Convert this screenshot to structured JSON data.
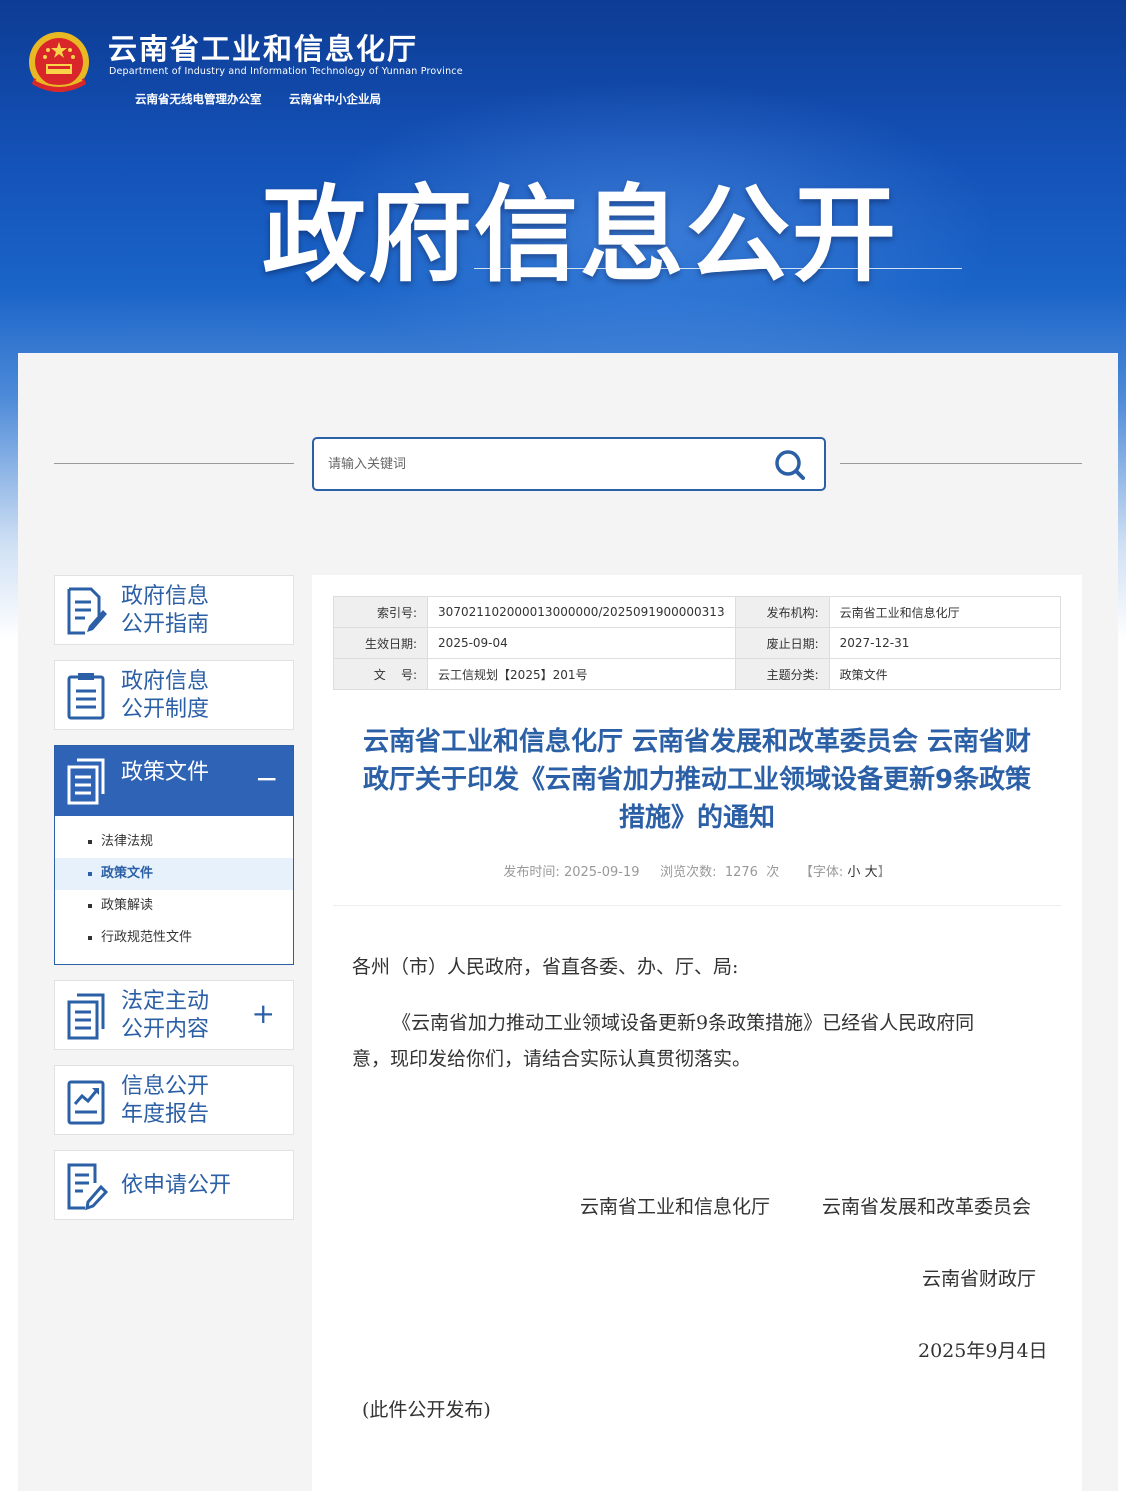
{
  "header": {
    "org_name": "云南省工业和信息化厅",
    "org_name_en": "Department of Industry and Information Technology of Yunnan Province",
    "sub_orgs": [
      "云南省无线电管理办公室",
      "云南省中小企业局"
    ],
    "banner_title": "政府信息公开"
  },
  "search": {
    "placeholder": "请输入关键词"
  },
  "sidebar": {
    "items": [
      {
        "line1": "政府信息",
        "line2": "公开指南",
        "icon": "document-pen-icon"
      },
      {
        "line1": "政府信息",
        "line2": "公开制度",
        "icon": "clipboard-icon"
      },
      {
        "line1": "政策文件",
        "icon": "files-icon",
        "toggle": "−",
        "active": true,
        "sub": [
          "法律法规",
          "政策文件",
          "政策解读",
          "行政规范性文件"
        ],
        "selected_sub": 1
      },
      {
        "line1": "法定主动",
        "line2": "公开内容",
        "icon": "files-icon",
        "toggle": "+"
      },
      {
        "line1": "信息公开",
        "line2": "年度报告",
        "icon": "chart-report-icon"
      },
      {
        "line1": "依申请公开",
        "icon": "edit-document-icon"
      }
    ]
  },
  "meta": {
    "index_label": "索引号:",
    "index_value": "307021102000013000000/2025091900000313",
    "publisher_label": "发布机构:",
    "publisher_value": "云南省工业和信息化厅",
    "effective_label": "生效日期:",
    "effective_value": "2025-09-04",
    "expire_label": "废止日期:",
    "expire_value": "2027-12-31",
    "doc_no_label": "文    号:",
    "doc_no_value": "云工信规划【2025】201号",
    "topic_label": "主题分类:",
    "topic_value": "政策文件"
  },
  "article": {
    "title_lines": [
      "云南省工业和信息化厅 云南省发展和改革委员会 云南省财",
      "政厅关于印发《云南省加力推动工业领域设备更新9条政策",
      "措施》的通知"
    ],
    "publish_label": "发布时间:",
    "publish_time": "2025-09-19",
    "views_label": "浏览次数:",
    "views": "1276",
    "views_unit": "次",
    "font_label": "【字体:",
    "font_small": "小",
    "font_large": "大",
    "font_end": "】",
    "salutation": "各州（市）人民政府，省直各委、办、厅、局:",
    "para1_line1": "《云南省加力推动工业领域设备更新9条政策措施》已经省人民政府同",
    "para1_line2": "意，现印发给你们，请结合实际认真贯彻落实。",
    "sign1": "云南省工业和信息化厅",
    "sign2": "云南省发展和改革委员会",
    "sign3": "云南省财政厅",
    "sign_date": "2025年9月4日",
    "note": "(此件公开发布)"
  },
  "colors": {
    "brand_blue": "#2b5fa6",
    "active_blue": "#2f63b5",
    "header_blue": "#1452b8"
  }
}
